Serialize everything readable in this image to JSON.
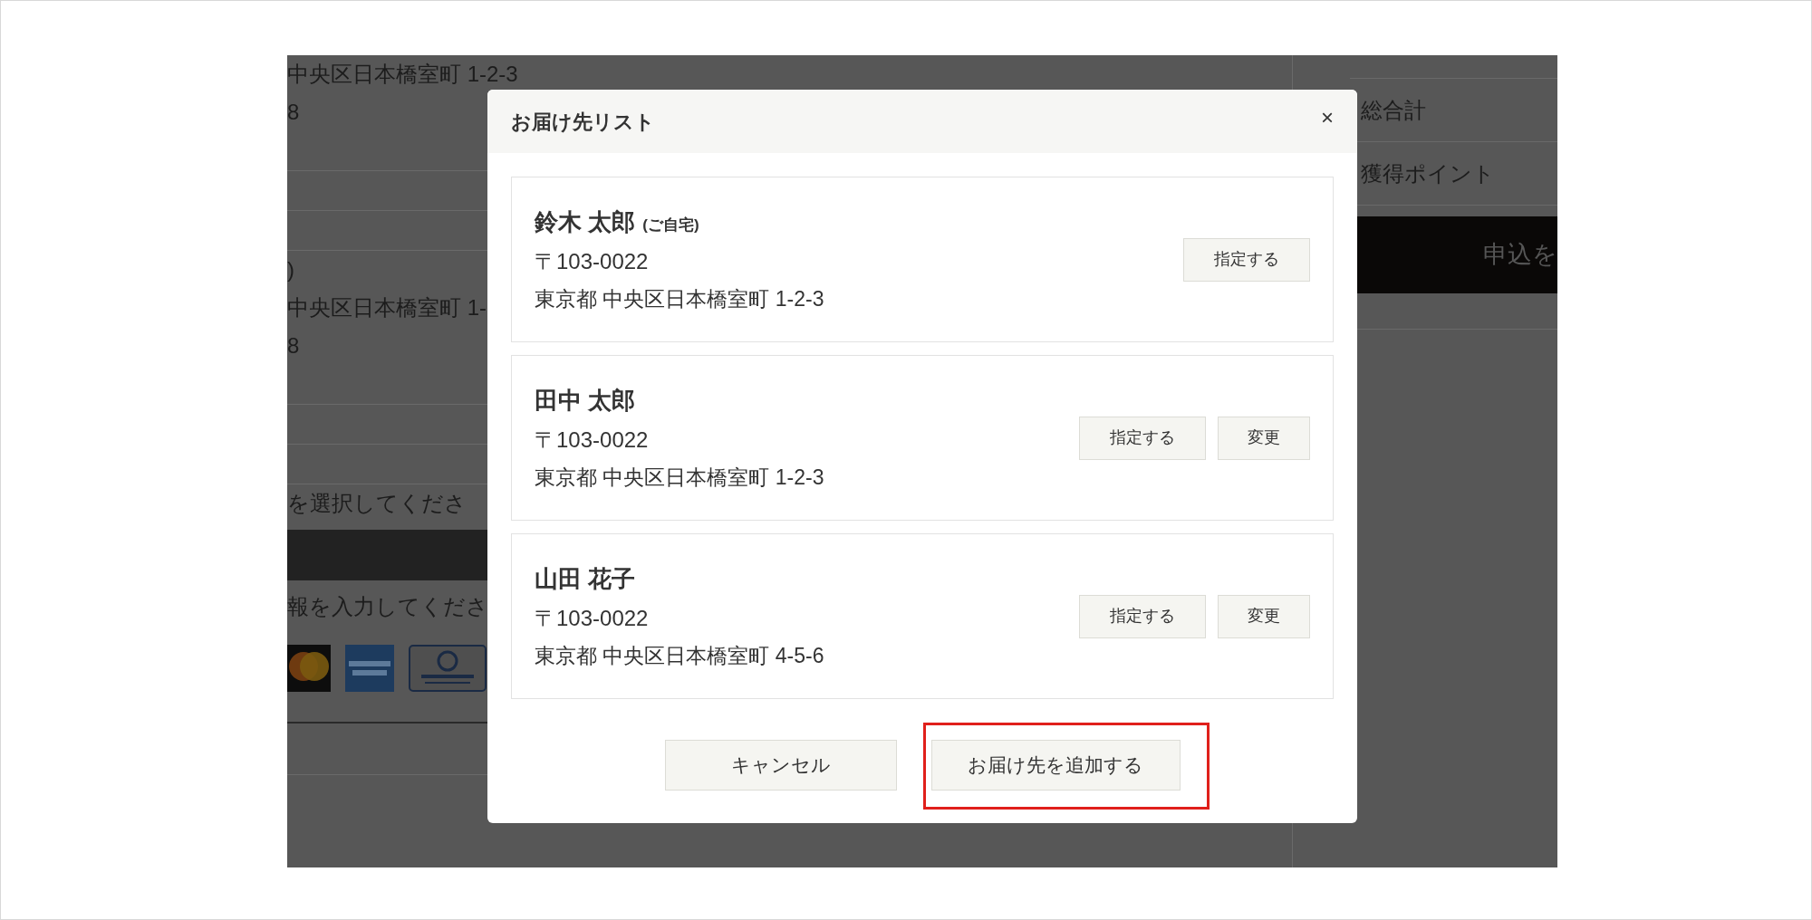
{
  "background": {
    "left": [
      {
        "kind": "text",
        "text": "中央区日本橋室町 1-2-3"
      },
      {
        "kind": "text",
        "text": "8"
      },
      {
        "kind": "rule"
      },
      {
        "kind": "rule"
      },
      {
        "kind": "rule"
      },
      {
        "kind": "text",
        "text": ")"
      },
      {
        "kind": "text",
        "text": "中央区日本橋室町 1-"
      },
      {
        "kind": "text",
        "text": "8"
      },
      {
        "kind": "rule"
      },
      {
        "kind": "rule"
      },
      {
        "kind": "rule"
      },
      {
        "kind": "text",
        "text": "を選択してくださ"
      },
      {
        "kind": "bar"
      },
      {
        "kind": "text",
        "text": "報を入力してくださ"
      },
      {
        "kind": "cards"
      }
    ],
    "right": [
      {
        "kind": "row",
        "text": "総合計"
      },
      {
        "kind": "row",
        "text": "獲得ポイント"
      },
      {
        "kind": "submit",
        "text": "申込を"
      }
    ]
  },
  "modal": {
    "title": "お届け先リスト",
    "close": "×",
    "addresses": [
      {
        "name": "鈴木 太郎",
        "note": "(ご自宅)",
        "postal": "〒103-0022",
        "address": "東京都 中央区日本橋室町 1-2-3",
        "buttons": [
          "指定する"
        ]
      },
      {
        "name": "田中 太郎",
        "postal": "〒103-0022",
        "address": "東京都 中央区日本橋室町 1-2-3",
        "buttons": [
          "指定する",
          "変更"
        ]
      },
      {
        "name": "山田 花子",
        "postal": "〒103-0022",
        "address": "東京都 中央区日本橋室町 4-5-6",
        "buttons": [
          "指定する",
          "変更"
        ]
      }
    ],
    "cancel": "キャンセル",
    "add": {
      "label": "お届け先を追加する",
      "highlighted": true
    }
  }
}
